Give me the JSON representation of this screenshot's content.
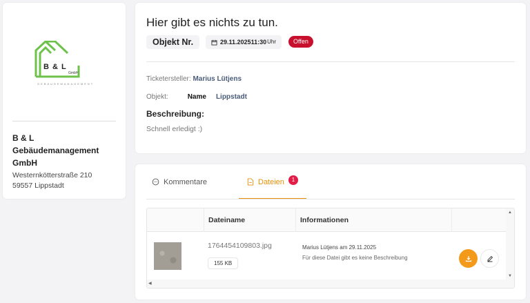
{
  "company": {
    "logo": {
      "text": "B & L",
      "gmbh": "GmbH",
      "tagline": "GEBÄUDEMANAGEMENT"
    },
    "name": "B & L Gebäudemanagement GmbH",
    "street": "Westernkötterstraße 210",
    "city": "59557 Lippstadt"
  },
  "ticket": {
    "title": "Hier gibt es nichts zu tun.",
    "object_chip": "Objekt Nr.",
    "date": "29.11.2025",
    "time": "11:30",
    "time_suffix": "Uhr",
    "status": "Offen",
    "creator_label": "Ticketersteller:",
    "creator_name": "Marius Lütjens",
    "object_label": "Objekt:",
    "object_name": "Name",
    "object_location": "Lippstadt",
    "description_label": "Beschreibung:",
    "description": "Schnell erledigt :)"
  },
  "tabs": {
    "comments": "Kommentare",
    "files": "Dateien",
    "files_count": "1"
  },
  "files_table": {
    "headers": {
      "filename": "Dateiname",
      "info": "Informationen"
    },
    "rows": [
      {
        "filename": "1764454109803.jpg",
        "size": "155 KB",
        "uploaded_by": "Marius Lütjens am 29.11.2025",
        "description": "Für diese Datei gibt es keine Beschreibung"
      }
    ]
  },
  "colors": {
    "accent": "#f39a1b",
    "status_open": "#c8102e",
    "logo_green": "#6cc24a",
    "link_blue": "#4a5b7a"
  },
  "icons": {
    "calendar": "calendar-icon",
    "comment": "comment-icon",
    "file": "file-icon",
    "download": "download-icon",
    "edit": "pencil-icon"
  }
}
